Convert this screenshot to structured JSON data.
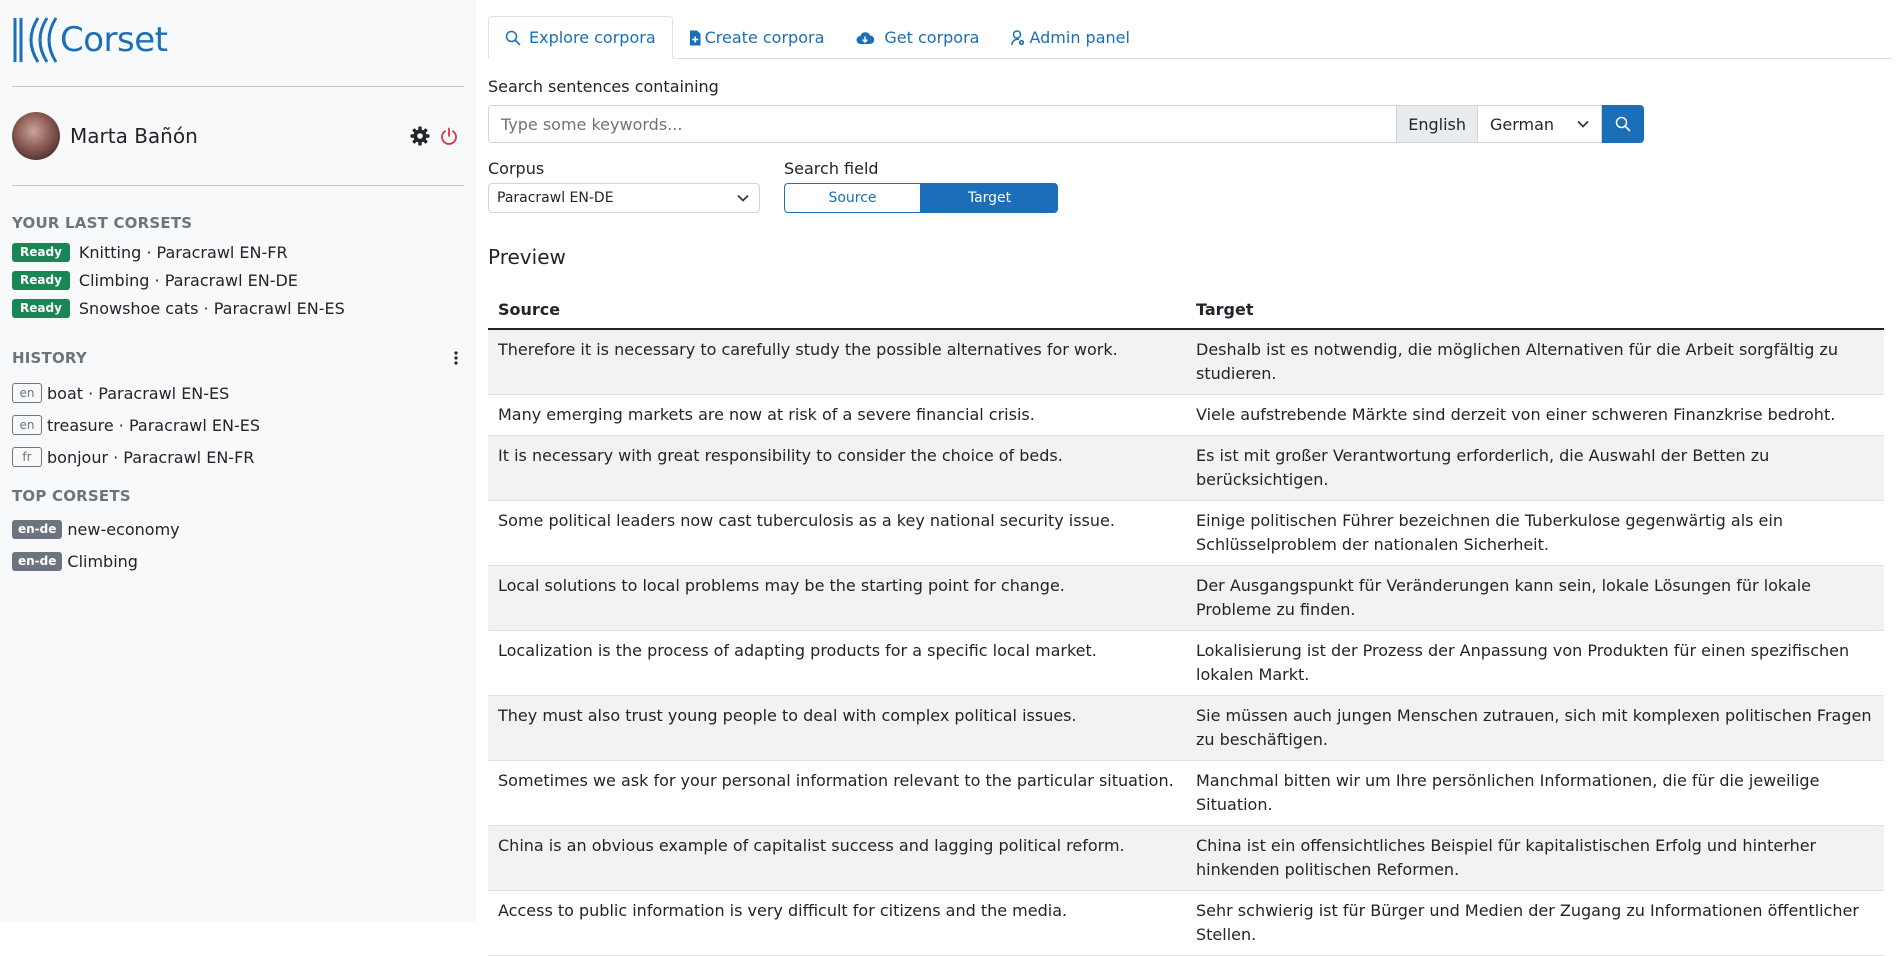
{
  "app": {
    "name": "Corset",
    "brand_color": "#1a6fb8"
  },
  "user": {
    "name": "Marta Bañón"
  },
  "last_corsets": {
    "title": "YOUR LAST CORSETS",
    "items": [
      {
        "status": "Ready",
        "label": "Knitting · Paracrawl EN-FR"
      },
      {
        "status": "Ready",
        "label": "Climbing · Paracrawl EN-DE"
      },
      {
        "status": "Ready",
        "label": "Snowshoe cats · Paracrawl EN-ES"
      }
    ]
  },
  "history": {
    "title": "HISTORY",
    "items": [
      {
        "lang": "en",
        "label": "boat · Paracrawl EN-ES"
      },
      {
        "lang": "en",
        "label": "treasure · Paracrawl EN-ES"
      },
      {
        "lang": "fr",
        "label": "bonjour · Paracrawl EN-FR"
      }
    ]
  },
  "top_corsets": {
    "title": "TOP CORSETS",
    "items": [
      {
        "pair": "en-de",
        "label": "new-economy"
      },
      {
        "pair": "en-de",
        "label": "Climbing"
      }
    ]
  },
  "tabs": [
    {
      "label": "Explore corpora",
      "icon": "search-icon",
      "active": true
    },
    {
      "label": "Create corpora",
      "icon": "file-plus-icon",
      "active": false
    },
    {
      "label": "Get corpora",
      "icon": "cloud-download-icon",
      "active": false
    },
    {
      "label": "Admin panel",
      "icon": "admin-icon",
      "active": false
    }
  ],
  "search": {
    "label": "Search sentences containing",
    "placeholder": "Type some keywords...",
    "value": "",
    "source_lang": "English",
    "target_lang": "German"
  },
  "corpus": {
    "label": "Corpus",
    "selected": "Paracrawl EN-DE"
  },
  "search_field": {
    "label": "Search field",
    "options": [
      "Source",
      "Target"
    ],
    "selected": "Target"
  },
  "preview": {
    "title": "Preview",
    "columns": [
      "Source",
      "Target"
    ],
    "rows": [
      [
        "Therefore it is necessary to carefully study the possible alternatives for work.",
        "Deshalb ist es notwendig, die möglichen Alternativen für die Arbeit sorgfältig zu studieren."
      ],
      [
        "Many emerging markets are now at risk of a severe financial crisis.",
        "Viele aufstrebende Märkte sind derzeit von einer schweren Finanzkrise bedroht."
      ],
      [
        "It is necessary with great responsibility to consider the choice of beds.",
        "Es ist mit großer Verantwortung erforderlich, die Auswahl der Betten zu berücksichtigen."
      ],
      [
        "Some political leaders now cast tuberculosis as a key national security issue.",
        "Einige politischen Führer bezeichnen die Tuberkulose gegenwärtig als ein Schlüsselproblem der nationalen Sicherheit."
      ],
      [
        "Local solutions to local problems may be the starting point for change.",
        "Der Ausgangspunkt für Veränderungen kann sein, lokale Lösungen für lokale Probleme zu finden."
      ],
      [
        "Localization is the process of adapting products for a specific local market.",
        "Lokalisierung ist der Prozess der Anpassung von Produkten für einen spezifischen lokalen Markt."
      ],
      [
        "They must also trust young people to deal with complex political issues.",
        "Sie müssen auch jungen Menschen zutrauen, sich mit komplexen politischen Fragen zu beschäftigen."
      ],
      [
        "Sometimes we ask for your personal information relevant to the particular situation.",
        "Manchmal bitten wir um Ihre persönlichen Informationen, die für die jeweilige Situation."
      ],
      [
        "China is an obvious example of capitalist success and lagging political reform.",
        "China ist ein offensichtliches Beispiel für kapitalistischen Erfolg und hinterher hinkenden politischen Reformen."
      ],
      [
        "Access to public information is very difficult for citizens and the media.",
        "Sehr schwierig ist für Bürger und Medien der Zugang zu Informationen öffentlicher Stellen."
      ]
    ]
  }
}
